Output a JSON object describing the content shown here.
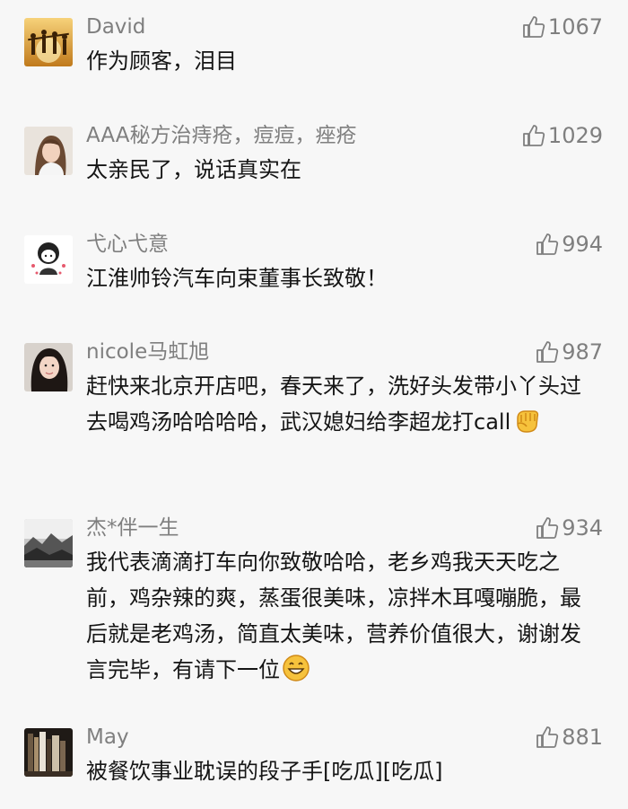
{
  "comments": [
    {
      "name": "David",
      "likes": "1067",
      "text": "作为顾客，泪目",
      "avatar": "sunset-people-avatar"
    },
    {
      "name": "AAA秘方治痔疮，痘痘，痤疮",
      "likes": "1029",
      "text": "太亲民了，说话真实在",
      "avatar": "girl-photo-avatar"
    },
    {
      "name": "弋心弋意",
      "likes": "994",
      "text": "江淮帅铃汽车向束董事长致敬！",
      "avatar": "cartoon-girl-avatar"
    },
    {
      "name": "nicole马虹旭",
      "likes": "987",
      "text": "赶快来北京开店吧，春天来了，洗好头发带小丫头过去喝鸡汤哈哈哈哈，武汉媳妇给李超龙打call",
      "emoji": "fist-emoji",
      "avatar": "woman-photo-avatar"
    },
    {
      "name": "杰*伴一生",
      "likes": "934",
      "text": "我代表滴滴打车向你致敬哈哈，老乡鸡我天天吃之前，鸡杂辣的爽，蒸蛋很美味，凉拌木耳嘎嘣脆，最后就是老鸡汤，简直太美味，营养价值很大，谢谢发言完毕，有请下一位",
      "emoji": "grin-emoji",
      "avatar": "landscape-avatar"
    },
    {
      "name": "May",
      "likes": "881",
      "text": "被餐饮事业耽误的段子手[吃瓜][吃瓜]",
      "avatar": "bookshelf-avatar"
    }
  ],
  "icons": {
    "like": "thumbs-up-icon"
  },
  "colors": {
    "background": "#f7f7f7",
    "name": "#7f7f7f",
    "text": "#151515"
  }
}
